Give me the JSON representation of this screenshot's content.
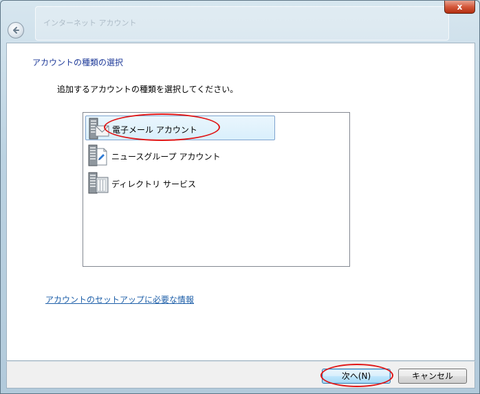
{
  "window": {
    "ghost_title": "インターネット アカウント",
    "close_label": "x"
  },
  "wizard": {
    "heading": "アカウントの種類の選択",
    "instruction": "追加するアカウントの種類を選択してください。",
    "account_types": [
      {
        "label": "電子メール アカウント",
        "icon": "email-server-icon",
        "selected": true
      },
      {
        "label": "ニュースグループ アカウント",
        "icon": "newsgroup-server-icon",
        "selected": false
      },
      {
        "label": "ディレクトリ サービス",
        "icon": "directory-server-icon",
        "selected": false
      }
    ],
    "help_link": "アカウントのセットアップに必要な情報"
  },
  "buttons": {
    "next": "次へ(N)",
    "cancel": "キャンセル"
  },
  "colors": {
    "heading": "#1e3a99",
    "link": "#1c5ea8",
    "annotation": "#e01515",
    "selection": "#d9effc"
  }
}
